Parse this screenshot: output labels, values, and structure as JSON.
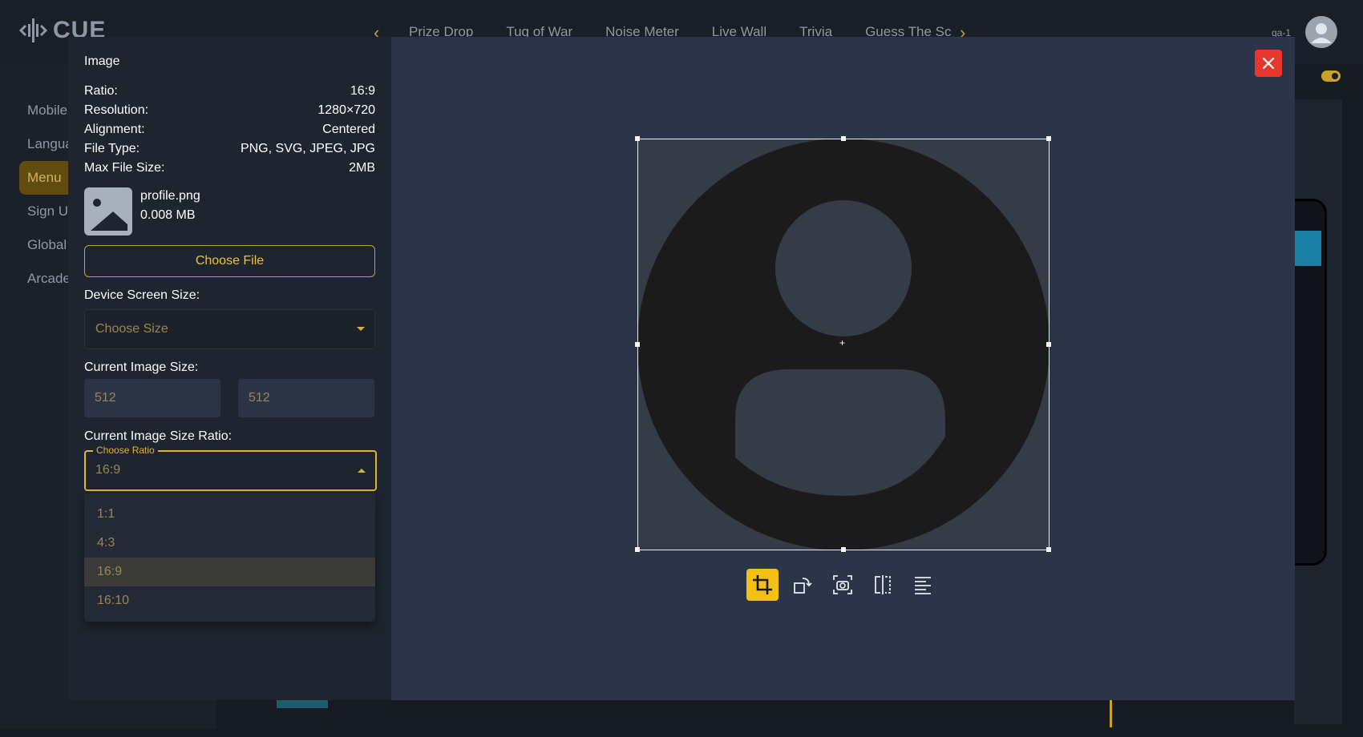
{
  "app": {
    "logo_text": "CUE",
    "tabs": [
      "Prize Drop",
      "Tug of War",
      "Noise Meter",
      "Live Wall",
      "Trivia",
      "Guess The Sc"
    ],
    "user_code": "qa-1",
    "sidebar": [
      "Mobile",
      "Langua",
      "Menu",
      "Sign U",
      "Global",
      "Arcade"
    ],
    "active_sidebar": "Menu"
  },
  "modal": {
    "title": "Image",
    "info": [
      {
        "label": "Ratio:",
        "value": "16:9"
      },
      {
        "label": "Resolution:",
        "value": "1280×720"
      },
      {
        "label": "Alignment:",
        "value": "Centered"
      },
      {
        "label": "File Type:",
        "value": "PNG, SVG, JPEG, JPG"
      },
      {
        "label": "Max File Size:",
        "value": "2MB"
      }
    ],
    "file": {
      "name": "profile.png",
      "size": "0.008 MB"
    },
    "choose_file_label": "Choose File",
    "device_screen_size": {
      "label": "Device Screen Size:",
      "placeholder": "Choose Size"
    },
    "current_image_size": {
      "label": "Current Image Size:",
      "width": "512",
      "height": "512"
    },
    "current_image_ratio": {
      "label": "Current Image Size Ratio:",
      "legend": "Choose Ratio",
      "value": "16:9",
      "options": [
        "1:1",
        "4:3",
        "16:9",
        "16:10"
      ],
      "selected_index": 2
    },
    "toolbar": [
      "crop-icon",
      "rotate-icon",
      "screenshot-icon",
      "flip-horizontal-icon",
      "align-icon"
    ],
    "active_tool": "crop-icon"
  },
  "colors": {
    "accent": "#f2c114",
    "close": "#e8372c",
    "modal_bg": "#2c3547",
    "left_pane_bg": "#1f2530"
  }
}
